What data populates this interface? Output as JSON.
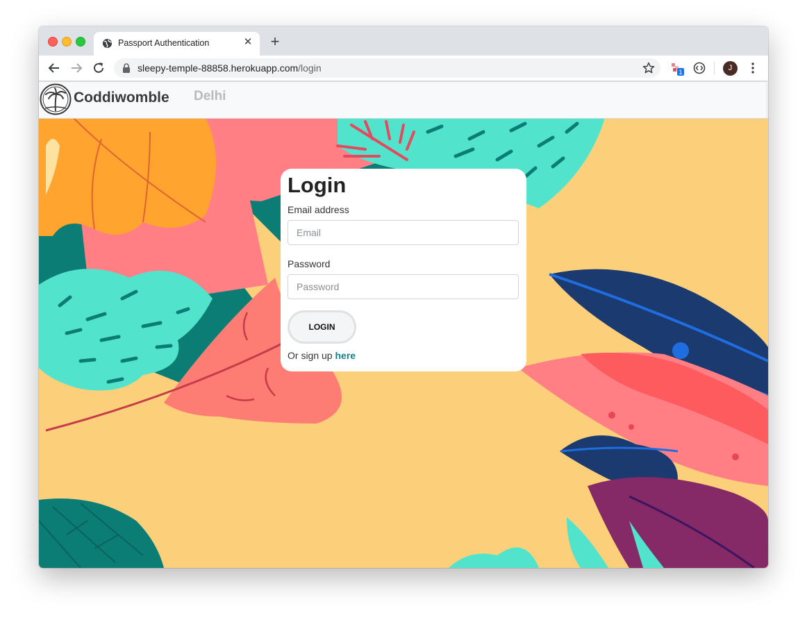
{
  "browser": {
    "tab_title": "Passport Authentication",
    "tab_close": "✕",
    "new_tab": "+",
    "url_host": "sleepy-temple-88858.herokuapp.com",
    "url_path": "/login",
    "extension_badge": "1",
    "profile_initial": "J"
  },
  "navbar": {
    "brand": "Coddiwomble",
    "link": "Delhi"
  },
  "login": {
    "title": "Login",
    "email_label": "Email address",
    "email_placeholder": "Email",
    "email_value": "",
    "password_label": "Password",
    "password_placeholder": "Password",
    "password_value": "",
    "submit_label": "LOGIN",
    "signup_prefix": "Or sign up ",
    "signup_link": "here"
  },
  "colors": {
    "background": "#fcd07b",
    "teal": "#52e3cd",
    "dark_teal": "#0c7d75",
    "orange": "#ffa52f",
    "coral": "#fd7d74",
    "pink": "#ff7f85",
    "navy": "#1b3a70",
    "blue": "#1f6ee0",
    "purple": "#852a66",
    "link": "#17808a"
  }
}
